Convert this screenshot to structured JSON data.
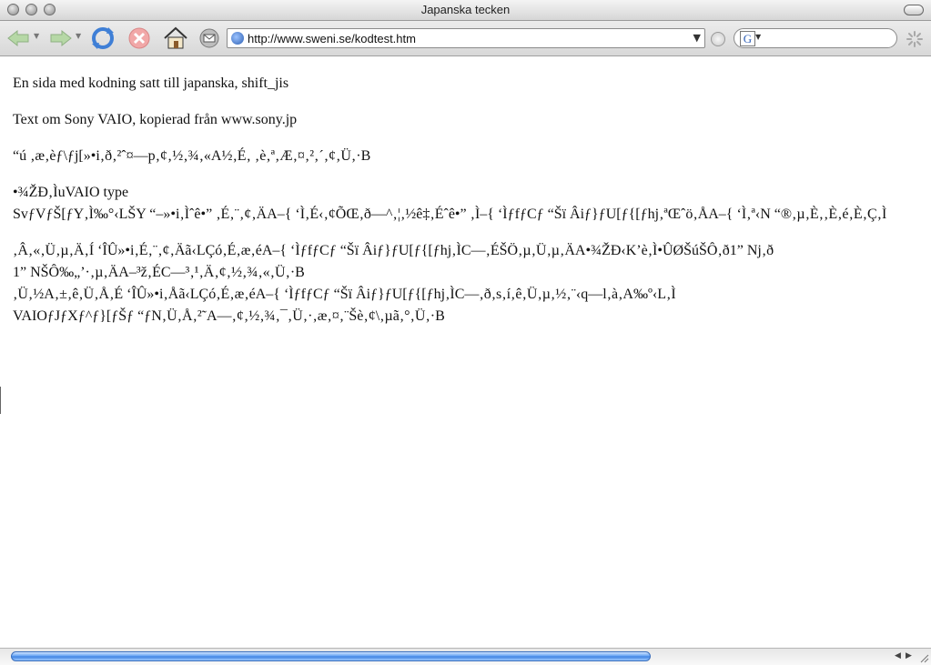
{
  "window": {
    "title": "Japanska tecken"
  },
  "toolbar": {
    "url": "http://www.sweni.se/kodtest.htm",
    "search_engine_letter": "G"
  },
  "content": {
    "paragraphs": [
      {
        "lines": [
          "En sida med kodning satt till japanska, shift_jis"
        ]
      },
      {
        "lines": [
          "Text om Sony VAIO, kopierad från www.sony.jp"
        ]
      },
      {
        "lines": [
          " “ú ‚æ‚èƒ\\ƒj[»•i‚ð‚²ˆ¤—p‚¢‚½‚¾‚«A½‚É‚ ‚è‚ª‚Æ‚¤‚²‚´‚¢‚Ü‚·B"
        ]
      },
      {
        "lines": [
          "•¾ŽÐ‚ÌuVAIO type",
          "SvƒVƒŠ[ƒY‚Ì‰°‹LŠY “–»•i‚Ìˆê•” ‚É‚¨‚¢‚ÄA–{  ‘Ì‚É‹‚¢ÕŒ‚ð—^‚¦‚½ê‡‚Éˆê•” ‚Ì–{  ‘ÌƒfƒCƒ “Šï  Âiƒ}ƒU[ƒ{[ƒhj‚ªŒˆö‚ÅA–{  ‘Ì‚ª‹N “®‚µ‚È‚‚È‚é‚È‚Ç‚Ì"
        ]
      },
      {
        "lines": [
          "‚Â‚«‚Ü‚µ‚Ä‚Í  ‘ÎÛ»•i‚É‚¨‚¢‚Äã‹LÇó‚É‚æ‚éA–{  ‘ÌƒfƒCƒ “Šï  Âiƒ}ƒU[ƒ{[ƒhj‚ÌC—‚ÉŠÖ‚µ‚Ü‚µ‚ÄA•¾ŽÐ‹K’è‚Ì•ÛØŠúŠÔ‚ð1” Nj‚ð",
          "1” NŠÔ‰„’·‚µ‚ÄA–³ž‚ÉC—³‚¹‚Ä‚¢‚½‚¾‚«‚Ü‚·B",
          "‚Ü‚½A‚±‚ê‚Ü‚Å‚É  ‘ÎÛ»•i‚Åã‹LÇó‚É‚æ‚éA–{  ‘ÌƒfƒCƒ “Šï  Âiƒ}ƒU[ƒ{[ƒhj‚ÌC—‚ð‚s‚í‚ê‚Ü‚µ‚½‚¨‹q—l‚à‚A‰º‹L‚Ì",
          "VAIOƒJƒXƒ^ƒ}[ƒŠƒ “ƒN‚Ü‚Å‚²˜A—‚¢‚½‚¾‚¯‚Ü‚·‚æ‚¤‚¨Šè‚¢\\‚µã‚°‚Ü‚·B"
        ]
      }
    ]
  },
  "colors": {
    "scroll_thumb": "#3b7fe0",
    "toolbar_bg": "#dcdcdc"
  }
}
